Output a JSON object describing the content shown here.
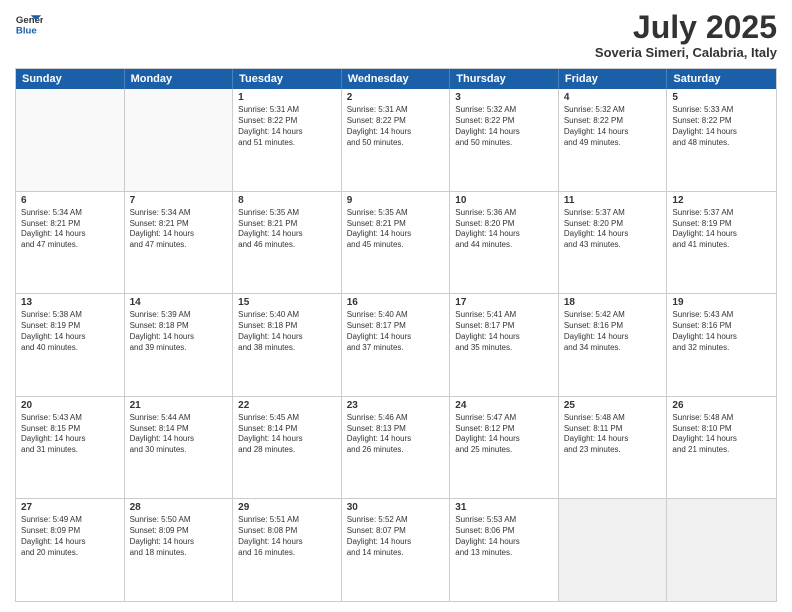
{
  "logo": {
    "line1": "General",
    "line2": "Blue"
  },
  "title": "July 2025",
  "location": "Soveria Simeri, Calabria, Italy",
  "weekdays": [
    "Sunday",
    "Monday",
    "Tuesday",
    "Wednesday",
    "Thursday",
    "Friday",
    "Saturday"
  ],
  "weeks": [
    [
      {
        "day": "",
        "info": [],
        "empty": true
      },
      {
        "day": "",
        "info": [],
        "empty": true
      },
      {
        "day": "1",
        "info": [
          "Sunrise: 5:31 AM",
          "Sunset: 8:22 PM",
          "Daylight: 14 hours",
          "and 51 minutes."
        ]
      },
      {
        "day": "2",
        "info": [
          "Sunrise: 5:31 AM",
          "Sunset: 8:22 PM",
          "Daylight: 14 hours",
          "and 50 minutes."
        ]
      },
      {
        "day": "3",
        "info": [
          "Sunrise: 5:32 AM",
          "Sunset: 8:22 PM",
          "Daylight: 14 hours",
          "and 50 minutes."
        ]
      },
      {
        "day": "4",
        "info": [
          "Sunrise: 5:32 AM",
          "Sunset: 8:22 PM",
          "Daylight: 14 hours",
          "and 49 minutes."
        ]
      },
      {
        "day": "5",
        "info": [
          "Sunrise: 5:33 AM",
          "Sunset: 8:22 PM",
          "Daylight: 14 hours",
          "and 48 minutes."
        ]
      }
    ],
    [
      {
        "day": "6",
        "info": [
          "Sunrise: 5:34 AM",
          "Sunset: 8:21 PM",
          "Daylight: 14 hours",
          "and 47 minutes."
        ]
      },
      {
        "day": "7",
        "info": [
          "Sunrise: 5:34 AM",
          "Sunset: 8:21 PM",
          "Daylight: 14 hours",
          "and 47 minutes."
        ]
      },
      {
        "day": "8",
        "info": [
          "Sunrise: 5:35 AM",
          "Sunset: 8:21 PM",
          "Daylight: 14 hours",
          "and 46 minutes."
        ]
      },
      {
        "day": "9",
        "info": [
          "Sunrise: 5:35 AM",
          "Sunset: 8:21 PM",
          "Daylight: 14 hours",
          "and 45 minutes."
        ]
      },
      {
        "day": "10",
        "info": [
          "Sunrise: 5:36 AM",
          "Sunset: 8:20 PM",
          "Daylight: 14 hours",
          "and 44 minutes."
        ]
      },
      {
        "day": "11",
        "info": [
          "Sunrise: 5:37 AM",
          "Sunset: 8:20 PM",
          "Daylight: 14 hours",
          "and 43 minutes."
        ]
      },
      {
        "day": "12",
        "info": [
          "Sunrise: 5:37 AM",
          "Sunset: 8:19 PM",
          "Daylight: 14 hours",
          "and 41 minutes."
        ]
      }
    ],
    [
      {
        "day": "13",
        "info": [
          "Sunrise: 5:38 AM",
          "Sunset: 8:19 PM",
          "Daylight: 14 hours",
          "and 40 minutes."
        ]
      },
      {
        "day": "14",
        "info": [
          "Sunrise: 5:39 AM",
          "Sunset: 8:18 PM",
          "Daylight: 14 hours",
          "and 39 minutes."
        ]
      },
      {
        "day": "15",
        "info": [
          "Sunrise: 5:40 AM",
          "Sunset: 8:18 PM",
          "Daylight: 14 hours",
          "and 38 minutes."
        ]
      },
      {
        "day": "16",
        "info": [
          "Sunrise: 5:40 AM",
          "Sunset: 8:17 PM",
          "Daylight: 14 hours",
          "and 37 minutes."
        ]
      },
      {
        "day": "17",
        "info": [
          "Sunrise: 5:41 AM",
          "Sunset: 8:17 PM",
          "Daylight: 14 hours",
          "and 35 minutes."
        ]
      },
      {
        "day": "18",
        "info": [
          "Sunrise: 5:42 AM",
          "Sunset: 8:16 PM",
          "Daylight: 14 hours",
          "and 34 minutes."
        ]
      },
      {
        "day": "19",
        "info": [
          "Sunrise: 5:43 AM",
          "Sunset: 8:16 PM",
          "Daylight: 14 hours",
          "and 32 minutes."
        ]
      }
    ],
    [
      {
        "day": "20",
        "info": [
          "Sunrise: 5:43 AM",
          "Sunset: 8:15 PM",
          "Daylight: 14 hours",
          "and 31 minutes."
        ]
      },
      {
        "day": "21",
        "info": [
          "Sunrise: 5:44 AM",
          "Sunset: 8:14 PM",
          "Daylight: 14 hours",
          "and 30 minutes."
        ]
      },
      {
        "day": "22",
        "info": [
          "Sunrise: 5:45 AM",
          "Sunset: 8:14 PM",
          "Daylight: 14 hours",
          "and 28 minutes."
        ]
      },
      {
        "day": "23",
        "info": [
          "Sunrise: 5:46 AM",
          "Sunset: 8:13 PM",
          "Daylight: 14 hours",
          "and 26 minutes."
        ]
      },
      {
        "day": "24",
        "info": [
          "Sunrise: 5:47 AM",
          "Sunset: 8:12 PM",
          "Daylight: 14 hours",
          "and 25 minutes."
        ]
      },
      {
        "day": "25",
        "info": [
          "Sunrise: 5:48 AM",
          "Sunset: 8:11 PM",
          "Daylight: 14 hours",
          "and 23 minutes."
        ]
      },
      {
        "day": "26",
        "info": [
          "Sunrise: 5:48 AM",
          "Sunset: 8:10 PM",
          "Daylight: 14 hours",
          "and 21 minutes."
        ]
      }
    ],
    [
      {
        "day": "27",
        "info": [
          "Sunrise: 5:49 AM",
          "Sunset: 8:09 PM",
          "Daylight: 14 hours",
          "and 20 minutes."
        ]
      },
      {
        "day": "28",
        "info": [
          "Sunrise: 5:50 AM",
          "Sunset: 8:09 PM",
          "Daylight: 14 hours",
          "and 18 minutes."
        ]
      },
      {
        "day": "29",
        "info": [
          "Sunrise: 5:51 AM",
          "Sunset: 8:08 PM",
          "Daylight: 14 hours",
          "and 16 minutes."
        ]
      },
      {
        "day": "30",
        "info": [
          "Sunrise: 5:52 AM",
          "Sunset: 8:07 PM",
          "Daylight: 14 hours",
          "and 14 minutes."
        ]
      },
      {
        "day": "31",
        "info": [
          "Sunrise: 5:53 AM",
          "Sunset: 8:06 PM",
          "Daylight: 14 hours",
          "and 13 minutes."
        ]
      },
      {
        "day": "",
        "info": [],
        "empty": true
      },
      {
        "day": "",
        "info": [],
        "empty": true
      }
    ]
  ]
}
